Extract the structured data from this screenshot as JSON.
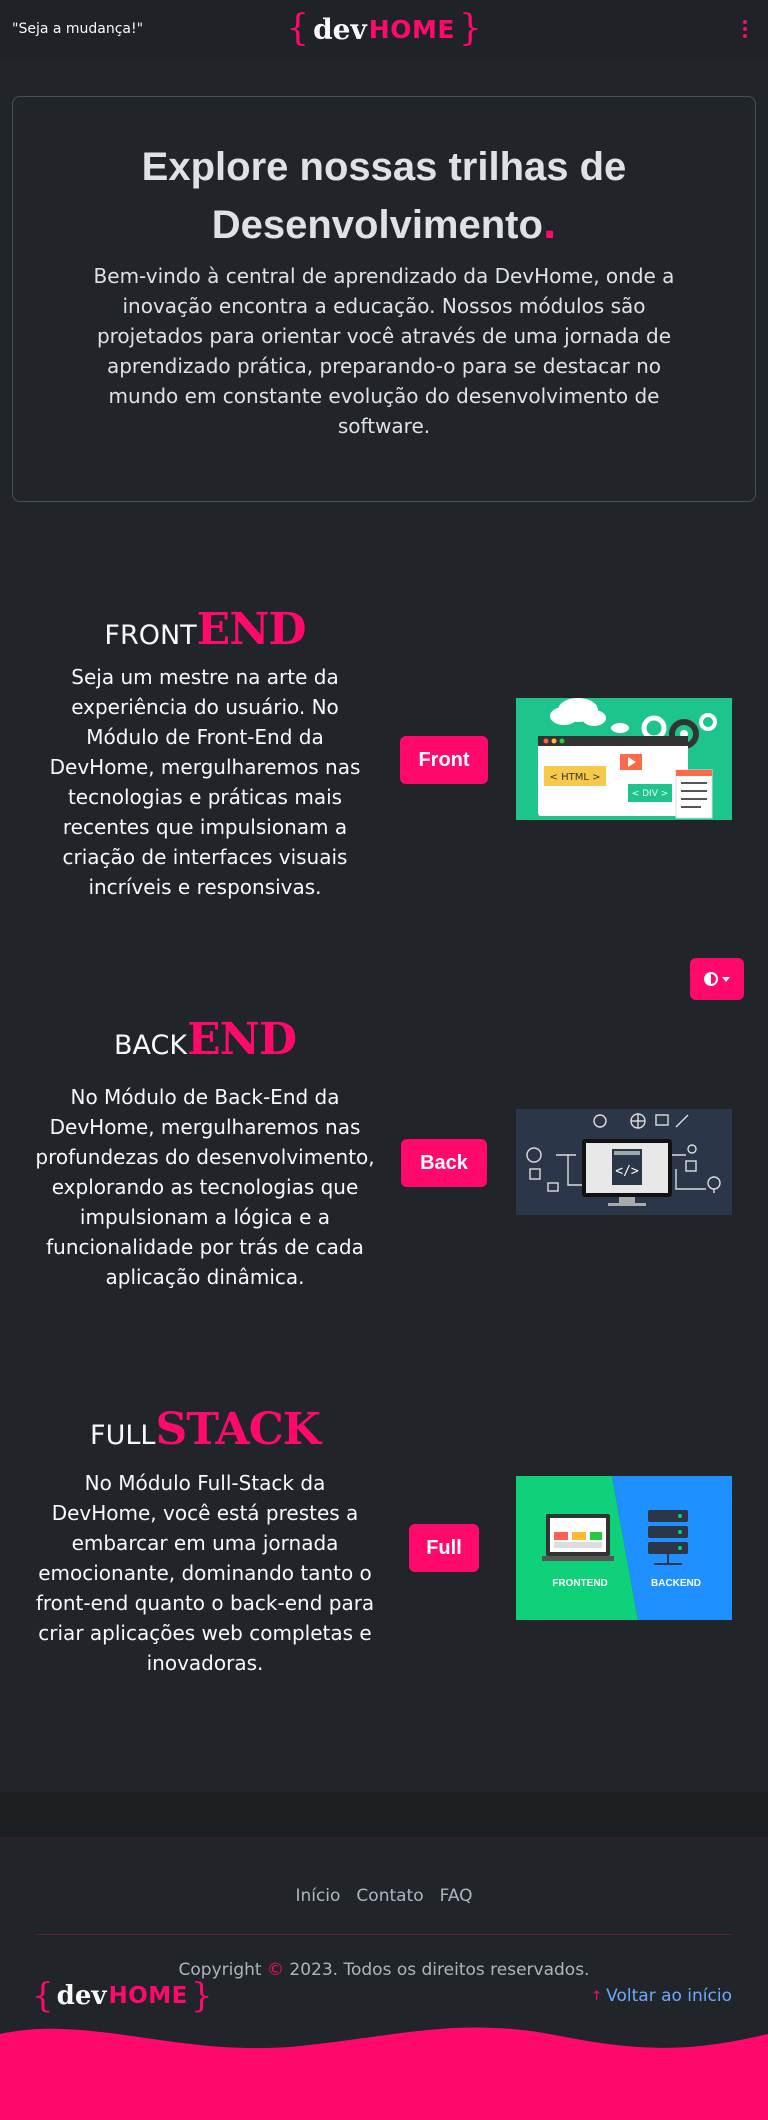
{
  "nav": {
    "slogan": "\"Seja a mudança!\"",
    "logo_brace_open": "{",
    "logo_dev": "dev",
    "logo_home": "HOME",
    "logo_brace_close": "}"
  },
  "hero": {
    "title": "Explore nossas trilhas de Desenvolvimento",
    "title_dot": ".",
    "text": "Bem-vindo à central de aprendizado da DevHome, onde a inovação encontra a educação. Nossos módulos são projetados para orientar você através de uma jornada de aprendizado prática, preparando-o para se destacar no mundo em constante evolução do desenvolvimento de software."
  },
  "tracks": [
    {
      "title_thin": "FRONT",
      "title_bold": "END",
      "text": "Seja um mestre na arte da experiência do usuário. No Módulo de Front-End da DevHome, mergulharemos nas tecnologias e práticas mais recentes que impulsionam a criação de interfaces visuais incríveis e responsivas.",
      "button": "Front",
      "image_labels": [
        "< HTML >",
        "< DIV >"
      ]
    },
    {
      "title_thin": "BACK",
      "title_bold": "END",
      "text": "No Módulo de Back-End da DevHome, mergulharemos nas profundezas do desenvolvimento, explorando as tecnologias que impulsionam a lógica e a funcionalidade por trás de cada aplicação dinâmica.",
      "button": "Back"
    },
    {
      "title_thin": "FULL",
      "title_bold": "STACK",
      "text": "No Módulo Full-Stack da DevHome, você está prestes a embarcar em uma jornada emocionante, dominando tanto o front-end quanto o back-end para criar aplicações web completas e inovadoras.",
      "button": "Full",
      "image_labels": [
        "FRONTEND",
        "BACKEND"
      ]
    }
  ],
  "theme_toggle": {
    "icon": "contrast-icon"
  },
  "footer": {
    "links": [
      "Início",
      "Contato",
      "FAQ"
    ],
    "copyright_prefix": "Copyright",
    "copyright_symbol": "©",
    "copyright_suffix": "2023. Todos os direitos reservados.",
    "back_to_top": "Voltar ao início",
    "back_to_top_arrow": "↑"
  },
  "colors": {
    "accent": "#ff0a6c",
    "background": "#212529",
    "text": "#dee2e6",
    "link": "#6ea8fe"
  }
}
